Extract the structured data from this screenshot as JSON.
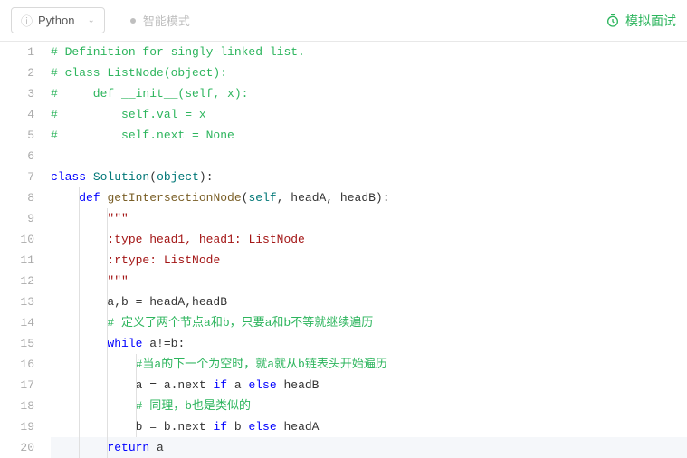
{
  "toolbar": {
    "language": "Python",
    "mode_label": "智能模式",
    "mock_interview_label": "模拟面试"
  },
  "code": {
    "lines": [
      {
        "n": 1,
        "tokens": [
          [
            "t-comment",
            "# Definition for singly-linked list."
          ]
        ]
      },
      {
        "n": 2,
        "tokens": [
          [
            "t-comment",
            "# class ListNode(object):"
          ]
        ]
      },
      {
        "n": 3,
        "tokens": [
          [
            "t-comment",
            "#     def __init__(self, x):"
          ]
        ]
      },
      {
        "n": 4,
        "tokens": [
          [
            "t-comment",
            "#         self.val = x"
          ]
        ]
      },
      {
        "n": 5,
        "tokens": [
          [
            "t-comment",
            "#         self.next = None"
          ]
        ]
      },
      {
        "n": 6,
        "tokens": []
      },
      {
        "n": 7,
        "tokens": [
          [
            "t-keyword",
            "class"
          ],
          [
            "t-id",
            " "
          ],
          [
            "t-classname",
            "Solution"
          ],
          [
            "t-id",
            "("
          ],
          [
            "t-builtin",
            "object"
          ],
          [
            "t-id",
            ")"
          ],
          [
            "t-op",
            ":"
          ]
        ]
      },
      {
        "n": 8,
        "indent": 1,
        "tokens": [
          [
            "t-id",
            "    "
          ],
          [
            "t-keyword",
            "def"
          ],
          [
            "t-id",
            " "
          ],
          [
            "t-fn",
            "getIntersectionNode"
          ],
          [
            "t-id",
            "("
          ],
          [
            "t-builtin",
            "self"
          ],
          [
            "t-id",
            ", headA, headB):"
          ]
        ]
      },
      {
        "n": 9,
        "indent": 2,
        "tokens": [
          [
            "t-id",
            "        "
          ],
          [
            "t-string",
            "\"\"\""
          ]
        ]
      },
      {
        "n": 10,
        "indent": 2,
        "tokens": [
          [
            "t-id",
            "        "
          ],
          [
            "t-string",
            ":type head1, head1: ListNode"
          ]
        ]
      },
      {
        "n": 11,
        "indent": 2,
        "tokens": [
          [
            "t-id",
            "        "
          ],
          [
            "t-string",
            ":rtype: ListNode"
          ]
        ]
      },
      {
        "n": 12,
        "indent": 2,
        "tokens": [
          [
            "t-id",
            "        "
          ],
          [
            "t-string",
            "\"\"\""
          ]
        ]
      },
      {
        "n": 13,
        "indent": 2,
        "tokens": [
          [
            "t-id",
            "        a,b = headA,headB"
          ]
        ]
      },
      {
        "n": 14,
        "indent": 2,
        "tokens": [
          [
            "t-id",
            "        "
          ],
          [
            "t-comment",
            "# 定义了两个节点a和b，只要a和b不等就继续遍历"
          ]
        ]
      },
      {
        "n": 15,
        "indent": 2,
        "tokens": [
          [
            "t-id",
            "        "
          ],
          [
            "t-keyword",
            "while"
          ],
          [
            "t-id",
            " a!=b:"
          ]
        ]
      },
      {
        "n": 16,
        "indent": 3,
        "tokens": [
          [
            "t-id",
            "            "
          ],
          [
            "t-comment",
            "#当a的下一个为空时，就a就从b链表头开始遍历"
          ]
        ]
      },
      {
        "n": 17,
        "indent": 3,
        "tokens": [
          [
            "t-id",
            "            a = a.next "
          ],
          [
            "t-keyword",
            "if"
          ],
          [
            "t-id",
            " a "
          ],
          [
            "t-keyword",
            "else"
          ],
          [
            "t-id",
            " headB"
          ]
        ]
      },
      {
        "n": 18,
        "indent": 3,
        "tokens": [
          [
            "t-id",
            "            "
          ],
          [
            "t-comment",
            "# 同理，b也是类似的"
          ]
        ]
      },
      {
        "n": 19,
        "indent": 3,
        "tokens": [
          [
            "t-id",
            "            b = b.next "
          ],
          [
            "t-keyword",
            "if"
          ],
          [
            "t-id",
            " b "
          ],
          [
            "t-keyword",
            "else"
          ],
          [
            "t-id",
            " headA"
          ]
        ]
      },
      {
        "n": 20,
        "indent": 2,
        "highlighted": true,
        "tokens": [
          [
            "t-id",
            "        "
          ],
          [
            "t-keyword",
            "return"
          ],
          [
            "t-id",
            " a"
          ]
        ]
      }
    ]
  }
}
